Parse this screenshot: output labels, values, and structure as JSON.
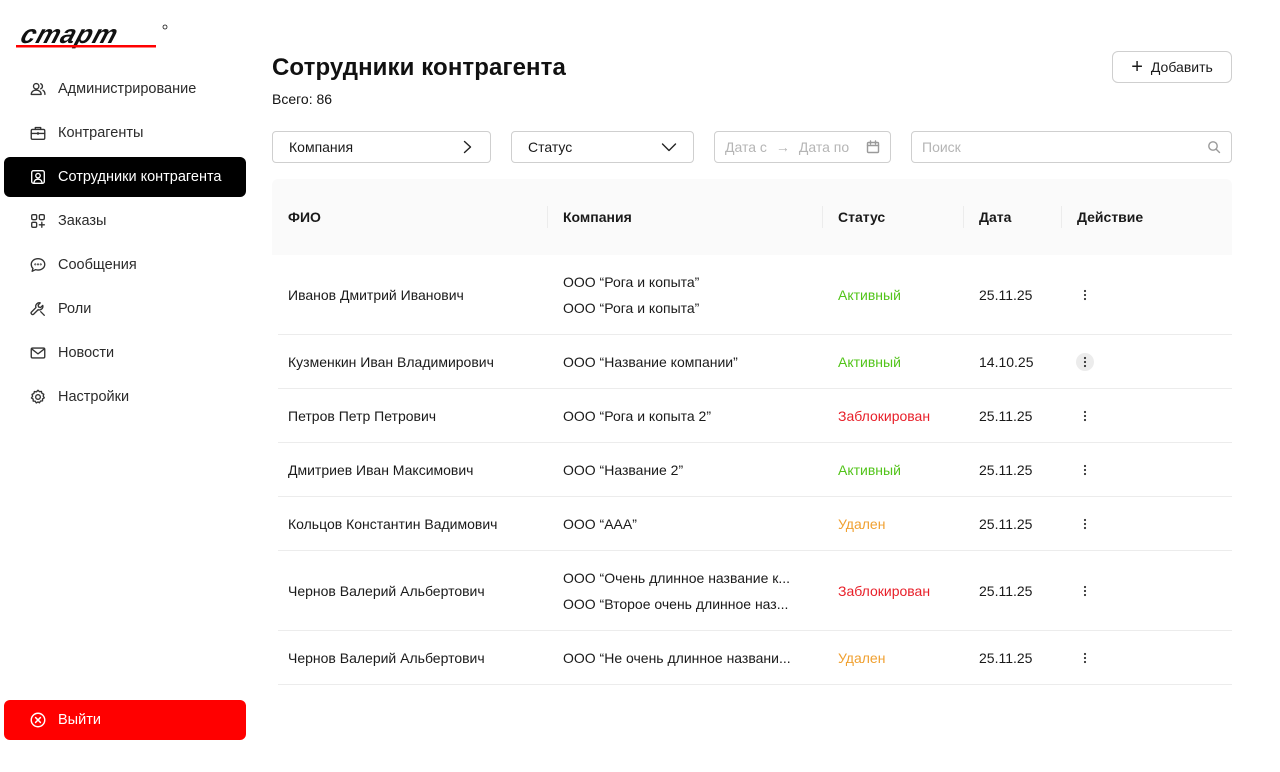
{
  "brand": {
    "logo_text": "старт",
    "accent": "#ff0000"
  },
  "sidebar": {
    "items": [
      {
        "label": "Администрирование",
        "icon": "users-icon",
        "active": false
      },
      {
        "label": "Контрагенты",
        "icon": "briefcase-icon",
        "active": false
      },
      {
        "label": "Сотрудники контрагента",
        "icon": "id-card-icon",
        "active": true
      },
      {
        "label": "Заказы",
        "icon": "grid-plus-icon",
        "active": false
      },
      {
        "label": "Сообщения",
        "icon": "chat-icon",
        "active": false
      },
      {
        "label": "Роли",
        "icon": "wrench-icon",
        "active": false
      },
      {
        "label": "Новости",
        "icon": "mail-icon",
        "active": false
      },
      {
        "label": "Настройки",
        "icon": "gear-icon",
        "active": false
      }
    ],
    "logout_label": "Выйти"
  },
  "header": {
    "title": "Сотрудники контрагента",
    "total": "Всего: 86",
    "add_label": "Добавить"
  },
  "filters": {
    "company": "Компания",
    "status": "Статус",
    "date_from": "Дата с",
    "date_to": "Дата по",
    "search_placeholder": "Поиск"
  },
  "table": {
    "columns": [
      "ФИО",
      "Компания",
      "Статус",
      "Дата",
      "Действие"
    ],
    "rows": [
      {
        "name": "Иванов Дмитрий Иванович",
        "companies": [
          "ООО “Рога и копыта”",
          "ООО “Рога и копыта”"
        ],
        "status": "Активный",
        "status_type": "active",
        "date": "25.11.25"
      },
      {
        "name": "Кузменкин Иван Владимирович",
        "companies": [
          "ООО “Название компании”"
        ],
        "status": "Активный",
        "status_type": "active",
        "date": "14.10.25"
      },
      {
        "name": "Петров Петр Петрович",
        "companies": [
          "ООО “Рога и копыта 2”"
        ],
        "status": "Заблокирован",
        "status_type": "blocked",
        "date": "25.11.25"
      },
      {
        "name": "Дмитриев Иван Максимович",
        "companies": [
          "ООО “Название 2”"
        ],
        "status": "Активный",
        "status_type": "active",
        "date": "25.11.25"
      },
      {
        "name": "Кольцов Константин Вадимович",
        "companies": [
          "ООО “ААА”"
        ],
        "status": "Удален",
        "status_type": "deleted",
        "date": "25.11.25"
      },
      {
        "name": "Чернов Валерий Альбертович",
        "companies": [
          "ООО “Очень длинное название к...",
          "ООО “Второе очень длинное наз..."
        ],
        "status": "Заблокирован",
        "status_type": "blocked",
        "date": "25.11.25"
      },
      {
        "name": "Чернов Валерий Альбертович",
        "companies": [
          "ООО “Не очень длинное названи..."
        ],
        "status": "Удален",
        "status_type": "deleted",
        "date": "25.11.25"
      }
    ]
  },
  "colors": {
    "active": "#52c41a",
    "blocked": "#e8202a",
    "deleted": "#f0a030"
  }
}
